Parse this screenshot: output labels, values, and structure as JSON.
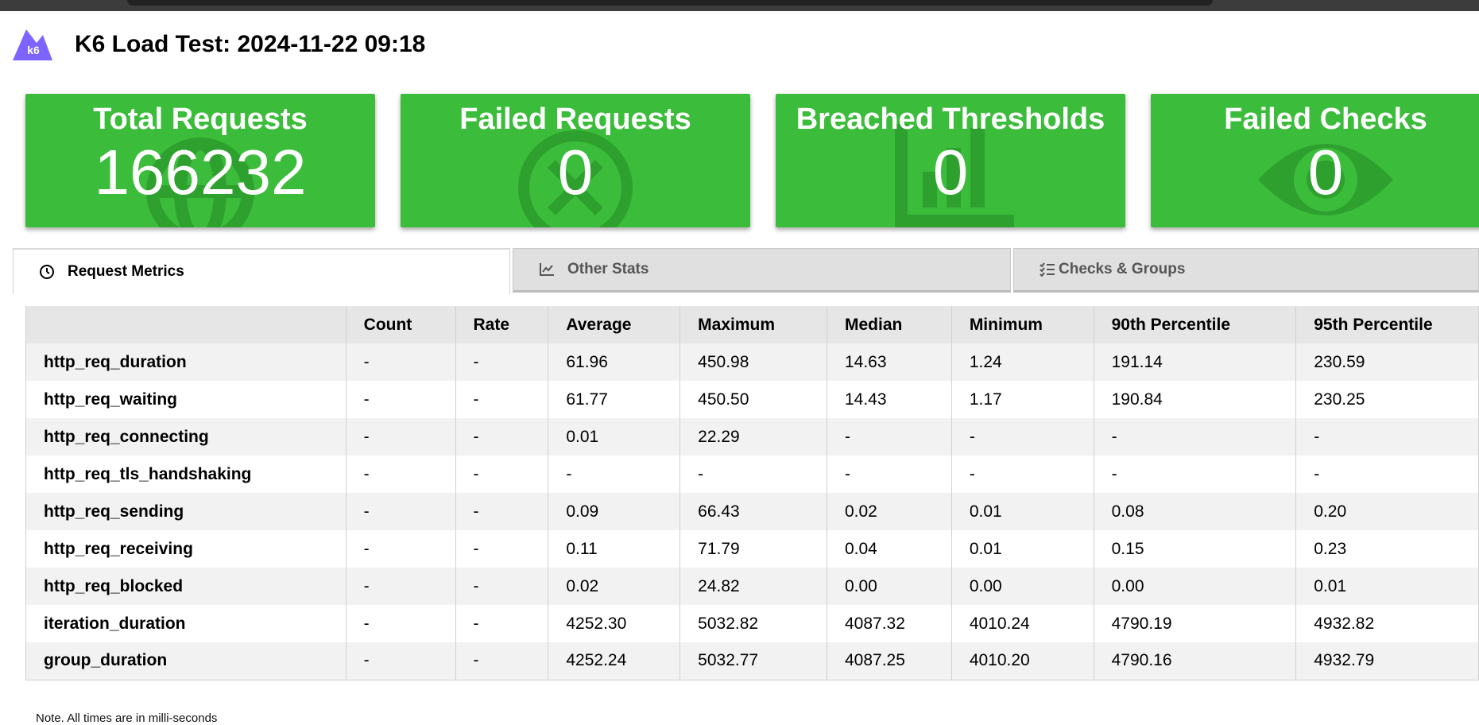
{
  "header": {
    "logo_text": "k6",
    "title": "K6 Load Test: 2024-11-22 09:18"
  },
  "colors": {
    "card_green": "#3bbd3b",
    "card_icon_green": "#2ea02e",
    "logo_purple": "#7d64ff"
  },
  "cards": [
    {
      "title": "Total Requests",
      "value": "166232",
      "icon": "globe-icon"
    },
    {
      "title": "Failed Requests",
      "value": "0",
      "icon": "x-circle-icon"
    },
    {
      "title": "Breached Thresholds",
      "value": "0",
      "icon": "bar-chart-icon"
    },
    {
      "title": "Failed Checks",
      "value": "0",
      "icon": "eye-icon"
    }
  ],
  "tabs": [
    {
      "label": "Request Metrics",
      "icon": "clock-icon",
      "active": true
    },
    {
      "label": "Other Stats",
      "icon": "line-chart-icon",
      "active": false
    },
    {
      "label": "Checks & Groups",
      "icon": "checklist-icon",
      "active": false
    }
  ],
  "table": {
    "columns": [
      "",
      "Count",
      "Rate",
      "Average",
      "Maximum",
      "Median",
      "Minimum",
      "90th Percentile",
      "95th Percentile"
    ],
    "rows": [
      [
        "http_req_duration",
        "-",
        "-",
        "61.96",
        "450.98",
        "14.63",
        "1.24",
        "191.14",
        "230.59"
      ],
      [
        "http_req_waiting",
        "-",
        "-",
        "61.77",
        "450.50",
        "14.43",
        "1.17",
        "190.84",
        "230.25"
      ],
      [
        "http_req_connecting",
        "-",
        "-",
        "0.01",
        "22.29",
        "-",
        "-",
        "-",
        "-"
      ],
      [
        "http_req_tls_handshaking",
        "-",
        "-",
        "-",
        "-",
        "-",
        "-",
        "-",
        "-"
      ],
      [
        "http_req_sending",
        "-",
        "-",
        "0.09",
        "66.43",
        "0.02",
        "0.01",
        "0.08",
        "0.20"
      ],
      [
        "http_req_receiving",
        "-",
        "-",
        "0.11",
        "71.79",
        "0.04",
        "0.01",
        "0.15",
        "0.23"
      ],
      [
        "http_req_blocked",
        "-",
        "-",
        "0.02",
        "24.82",
        "0.00",
        "0.00",
        "0.00",
        "0.01"
      ],
      [
        "iteration_duration",
        "-",
        "-",
        "4252.30",
        "5032.82",
        "4087.32",
        "4010.24",
        "4790.19",
        "4932.82"
      ],
      [
        "group_duration",
        "-",
        "-",
        "4252.24",
        "5032.77",
        "4087.25",
        "4010.20",
        "4790.16",
        "4932.79"
      ]
    ]
  },
  "note": "Note. All times are in milli-seconds"
}
